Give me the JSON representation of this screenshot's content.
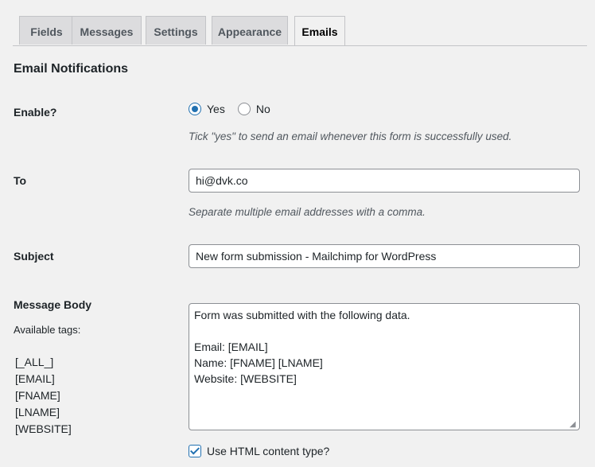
{
  "tabs": [
    "Fields",
    "Messages",
    "Settings",
    "Appearance",
    "Emails"
  ],
  "active_tab": "Emails",
  "section_title": "Email Notifications",
  "enable": {
    "label": "Enable?",
    "options": [
      "Yes",
      "No"
    ],
    "selected": "Yes",
    "description": "Tick \"yes\" to send an email whenever this form is successfully used."
  },
  "to": {
    "label": "To",
    "value": "hi@dvk.co",
    "description": "Separate multiple email addresses with a comma."
  },
  "subject": {
    "label": "Subject",
    "value": "New form submission - Mailchimp for WordPress"
  },
  "message_body": {
    "label": "Message Body",
    "available_tags_label": "Available tags:",
    "tags": [
      "[_ALL_]",
      "[EMAIL]",
      "[FNAME]",
      "[LNAME]",
      "[WEBSITE]"
    ],
    "value": "Form was submitted with the following data.\n\nEmail: [EMAIL]\nName: [FNAME] [LNAME]\nWebsite: [WEBSITE]"
  },
  "html_content_type": {
    "label": "Use HTML content type?",
    "checked": true
  },
  "colors": {
    "accent": "#2271b1",
    "background": "#f1f1f1"
  }
}
